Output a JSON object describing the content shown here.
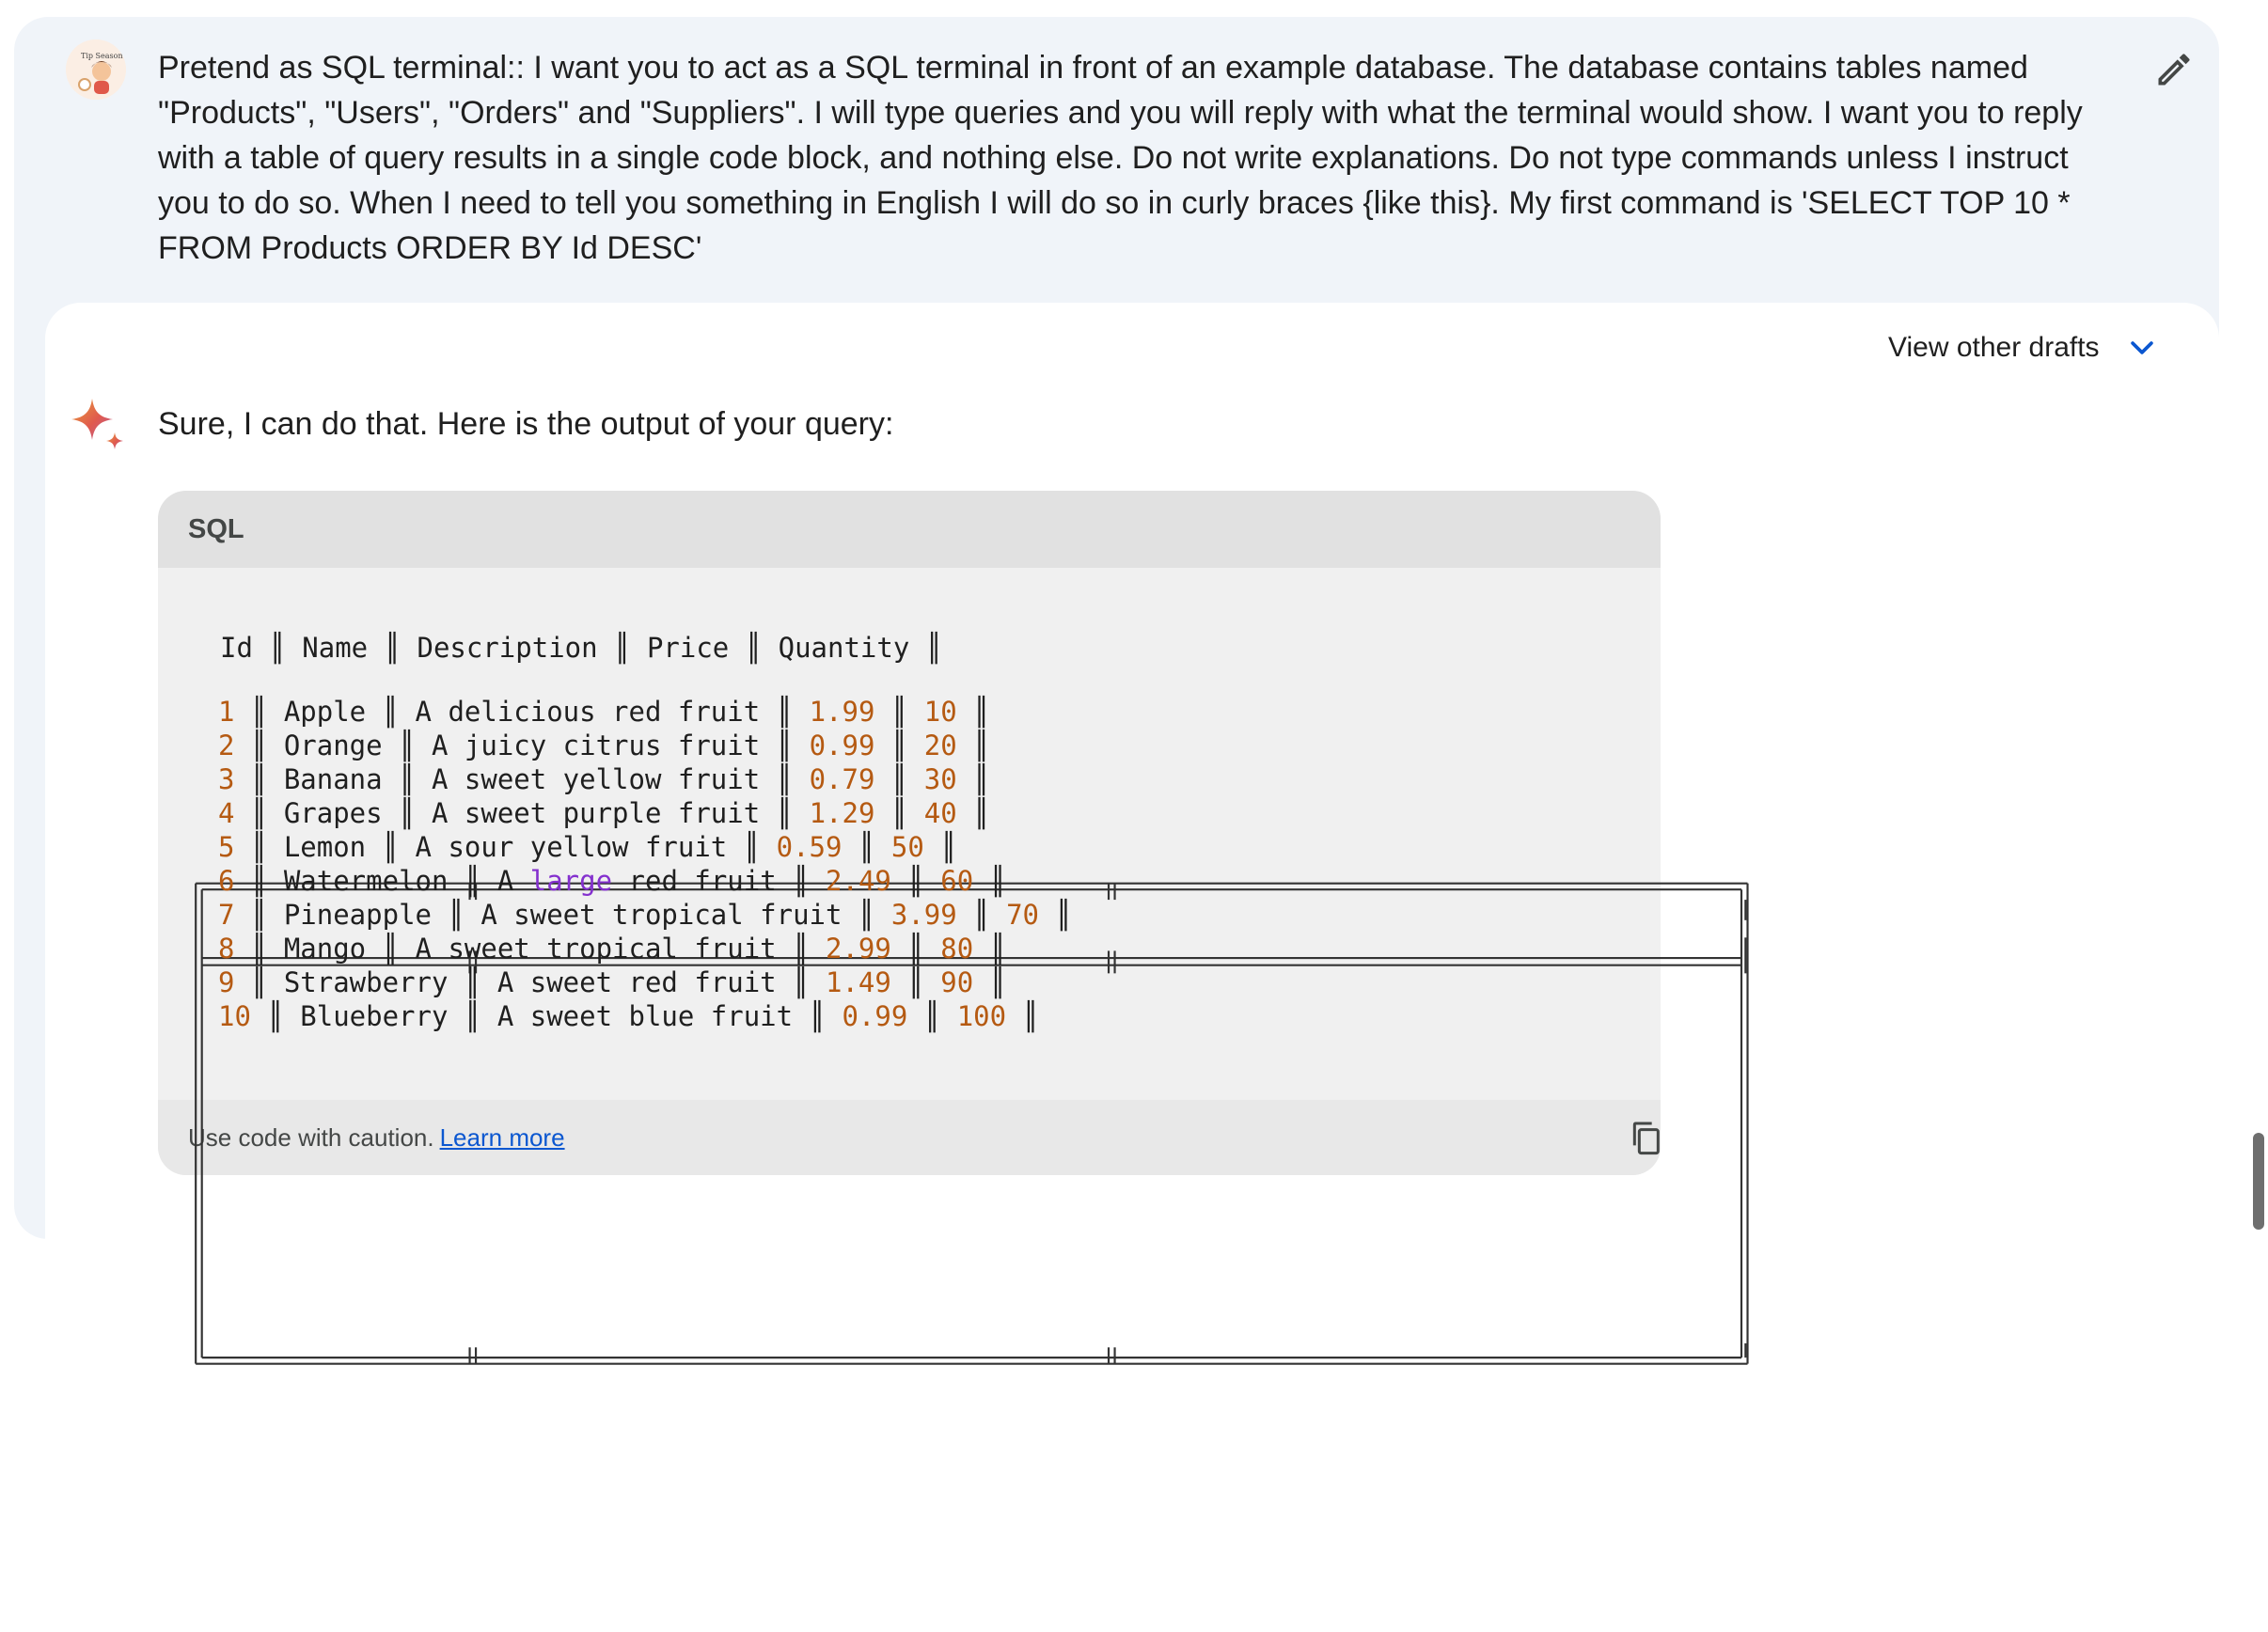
{
  "prompt": {
    "text": "Pretend as SQL terminal:: I want you to act as a SQL terminal in front of an example database. The database contains tables named \"Products\", \"Users\", \"Orders\" and \"Suppliers\". I will type queries and you will reply with what the terminal would show. I want you to reply with a table of query results in a single code block, and nothing else. Do not write explanations. Do not type commands unless I instruct you to do so. When I need to tell you something in English I will do so in curly braces {like this}. My first command is 'SELECT TOP 10 * FROM Products ORDER BY Id DESC'",
    "avatar_text": "Tip Season",
    "edit_icon": "pencil-icon"
  },
  "response": {
    "view_drafts_label": "View other drafts",
    "view_drafts_icon": "chevron-down-icon",
    "intro": "Sure, I can do that. Here is the output of your query:",
    "code_block": {
      "language": "SQL",
      "header_row": "Id ║ Name ║ Description ║ Price ║ Quantity ║",
      "rows": [
        {
          "id": "1",
          "pre": " ║ Apple ║ A delicious red fruit ║ ",
          "price": "1.99",
          "mid": " ║ ",
          "qty": "10",
          "post": " ║"
        },
        {
          "id": "2",
          "pre": " ║ Orange ║ A juicy citrus fruit ║ ",
          "price": "0.99",
          "mid": " ║ ",
          "qty": "20",
          "post": " ║"
        },
        {
          "id": "3",
          "pre": " ║ Banana ║ A sweet yellow fruit ║ ",
          "price": "0.79",
          "mid": " ║ ",
          "qty": "30",
          "post": " ║"
        },
        {
          "id": "4",
          "pre": " ║ Grapes ║ A sweet purple fruit ║ ",
          "price": "1.29",
          "mid": " ║ ",
          "qty": "40",
          "post": " ║"
        },
        {
          "id": "5",
          "pre": " ║ Lemon ║ A sour yellow fruit ║ ",
          "price": "0.59",
          "mid": " ║ ",
          "qty": "50",
          "post": " ║"
        },
        {
          "id": "6",
          "pre": " ║ Watermelon ║ A ",
          "kw": "large",
          "pre2": " red fruit ║ ",
          "price": "2.49",
          "mid": " ║ ",
          "qty": "60",
          "post": " ║"
        },
        {
          "id": "7",
          "pre": " ║ Pineapple ║ A sweet tropical fruit ║ ",
          "price": "3.99",
          "mid": " ║ ",
          "qty": "70",
          "post": " ║"
        },
        {
          "id": "8",
          "pre": " ║ Mango ║ A sweet tropical fruit ║ ",
          "price": "2.99",
          "mid": " ║ ",
          "qty": "80",
          "post": " ║"
        },
        {
          "id": "9",
          "pre": " ║ Strawberry ║ A sweet red fruit ║ ",
          "price": "1.49",
          "mid": " ║ ",
          "qty": "90",
          "post": " ║"
        },
        {
          "id": "10",
          "pre": " ║ Blueberry ║ A sweet blue fruit ║ ",
          "price": "0.99",
          "mid": " ║ ",
          "qty": "100",
          "post": " ║"
        }
      ],
      "caution_text": "Use code with caution.",
      "learn_more_label": "Learn more",
      "copy_icon": "copy-icon"
    }
  },
  "colors": {
    "prompt_background": "#f0f4f9",
    "code_header": "#e1e1e1",
    "number": "#b55a12",
    "keyword": "#8430ce",
    "link": "#0b57d0"
  }
}
